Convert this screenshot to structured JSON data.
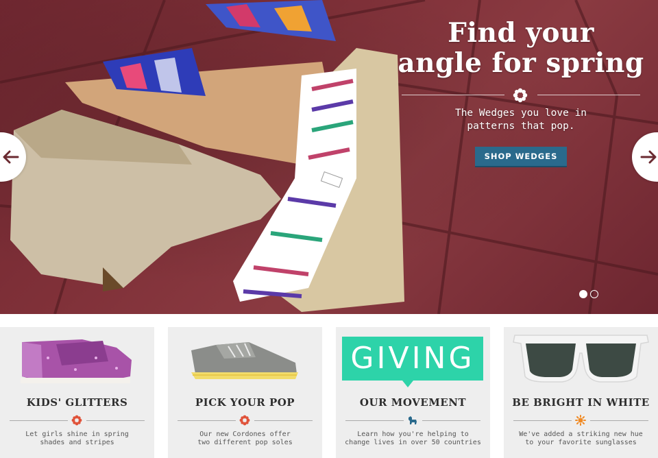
{
  "hero": {
    "headline_line1": "Find your",
    "headline_line2": "angle for spring",
    "subtext_line1": "The Wedges you love in",
    "subtext_line2": "patterns that pop.",
    "cta_label": "SHOP WEDGES",
    "prev_icon": "arrow-left-icon",
    "next_icon": "arrow-right-icon",
    "slides_total": 2,
    "active_slide": 1,
    "colors": {
      "background": "#7a2d35",
      "cta": "#2a6a8c"
    }
  },
  "tiles": [
    {
      "title": "KIDS' GLITTERS",
      "desc_line1": "Let girls shine in spring",
      "desc_line2": "shades and stripes",
      "icon": "flower-icon",
      "icon_color": "#e0533a"
    },
    {
      "title": "PICK YOUR POP",
      "desc_line1": "Our new Cordones offer",
      "desc_line2": "two different pop soles",
      "icon": "flower-icon",
      "icon_color": "#e0533a"
    },
    {
      "banner": "GIVING",
      "title": "OUR MOVEMENT",
      "desc_line1": "Learn how you're helping to",
      "desc_line2": "change lives in over 50 countries",
      "icon": "dog-icon",
      "icon_color": "#2a6a8c",
      "banner_color": "#2dd3a9"
    },
    {
      "title": "BE BRIGHT IN WHITE",
      "desc_line1": "We've added a striking new hue",
      "desc_line2": "to your favorite sunglasses",
      "icon": "sun-icon",
      "icon_color": "#f08a24"
    }
  ]
}
